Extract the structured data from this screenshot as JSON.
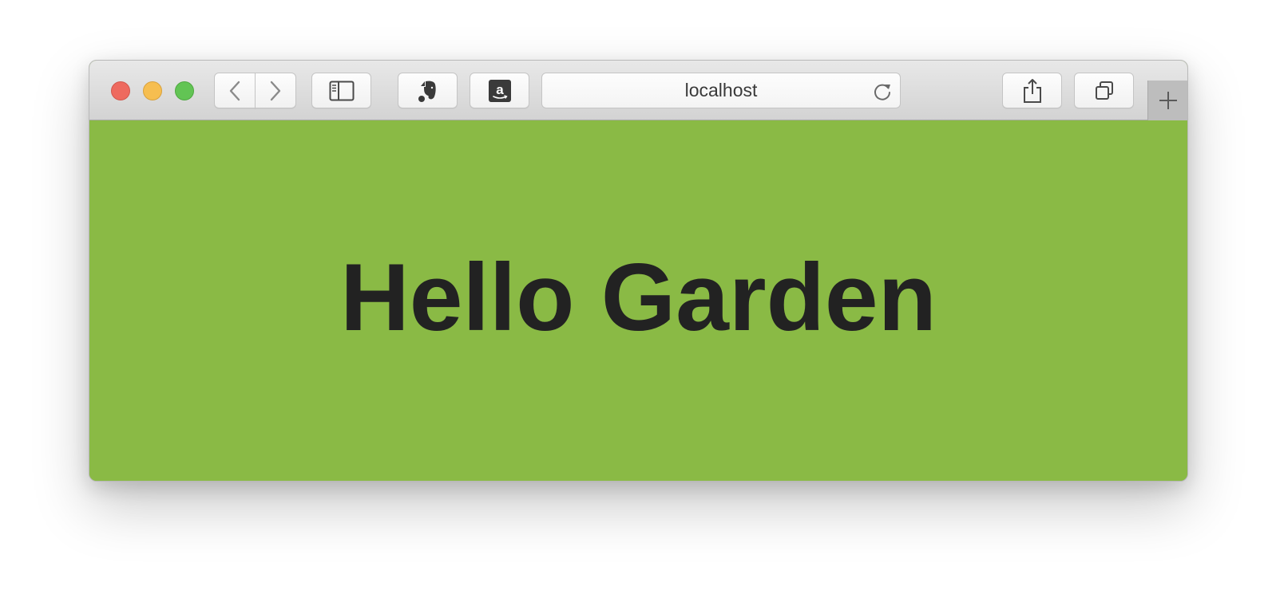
{
  "browser": {
    "address": "localhost",
    "buttons": {
      "back_icon": "chevron-left-icon",
      "forward_icon": "chevron-right-icon",
      "sidebar_icon": "sidebar-icon",
      "evernote_icon": "evernote-icon",
      "amazon_icon": "amazon-icon",
      "reload_icon": "reload-icon",
      "share_icon": "share-icon",
      "tabs_icon": "tabs-overview-icon",
      "new_tab_icon": "plus-icon"
    }
  },
  "page": {
    "headline": "Hello Garden",
    "background_color": "#8aba45",
    "text_color": "#222222"
  },
  "colors": {
    "close": "#ee6a5f",
    "minimize": "#f6be50",
    "maximize": "#62c454"
  }
}
